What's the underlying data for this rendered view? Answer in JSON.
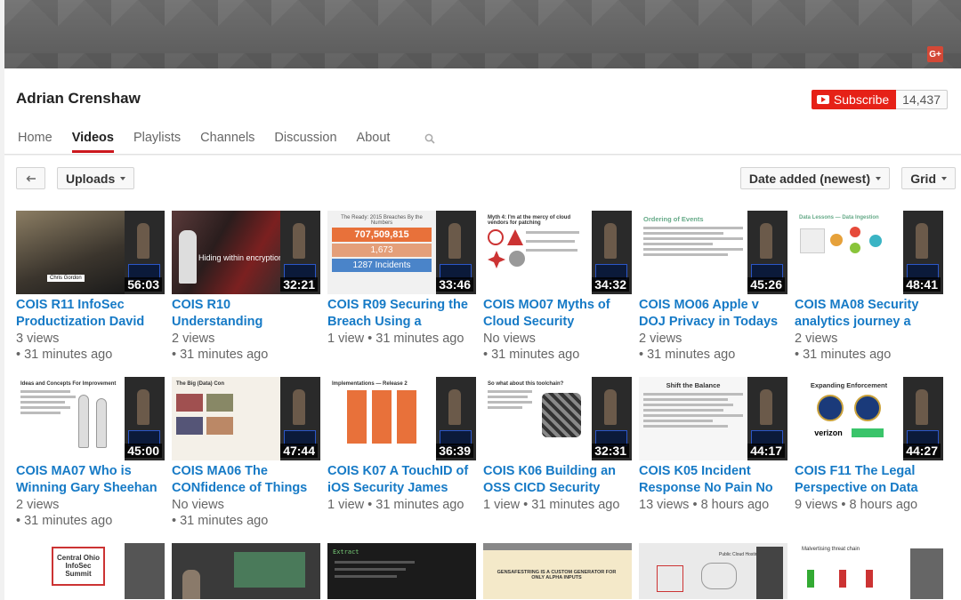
{
  "channel": {
    "name": "Adrian Crenshaw",
    "subscribe_label": "Subscribe",
    "subscriber_count": "14,437",
    "gplus_label": "G+"
  },
  "tabs": [
    {
      "label": "Home",
      "active": false
    },
    {
      "label": "Videos",
      "active": true
    },
    {
      "label": "Playlists",
      "active": false
    },
    {
      "label": "Channels",
      "active": false
    },
    {
      "label": "Discussion",
      "active": false
    },
    {
      "label": "About",
      "active": false
    }
  ],
  "toolbar": {
    "uploads_label": "Uploads",
    "sort_label": "Date added (newest)",
    "view_label": "Grid"
  },
  "colors": {
    "accent": "#cc181e",
    "subscribe": "#e62117",
    "link": "#167ac6"
  },
  "videos": [
    {
      "title": "COIS R11 InfoSec Productization David",
      "views": "3 views",
      "age": "31 minutes ago",
      "meta_inline": false,
      "duration": "56:03"
    },
    {
      "title": "COIS R10 Understanding",
      "views": "2 views",
      "age": "31 minutes ago",
      "meta_inline": false,
      "duration": "32:21"
    },
    {
      "title": "COIS R09 Securing the Breach Using a Holisti…",
      "views": "1 view",
      "age": "31 minutes ago",
      "meta_inline": true,
      "duration": "33:46"
    },
    {
      "title": "COIS MO07 Myths of Cloud Security",
      "views": "No views",
      "age": "31 minutes ago",
      "meta_inline": false,
      "duration": "34:32"
    },
    {
      "title": "COIS MO06 Apple v DOJ Privacy in Todays",
      "views": "2 views",
      "age": "31 minutes ago",
      "meta_inline": false,
      "duration": "45:26"
    },
    {
      "title": "COIS MA08 Security analytics journey a",
      "views": "2 views",
      "age": "31 minutes ago",
      "meta_inline": false,
      "duration": "48:41"
    },
    {
      "title": "COIS MA07 Who is Winning Gary Sheehan",
      "views": "2 views",
      "age": "31 minutes ago",
      "meta_inline": false,
      "duration": "45:00"
    },
    {
      "title": "COIS MA06 The CONfidence of Things",
      "views": "No views",
      "age": "31 minutes ago",
      "meta_inline": false,
      "duration": "47:44"
    },
    {
      "title": "COIS K07 A TouchID of iOS Security James",
      "views": "1 view",
      "age": "31 minutes ago",
      "meta_inline": true,
      "duration": "36:39"
    },
    {
      "title": "COIS K06 Building an OSS CICD Security",
      "views": "1 view",
      "age": "31 minutes ago",
      "meta_inline": true,
      "duration": "32:31"
    },
    {
      "title": "COIS K05 Incident Response No Pain No",
      "views": "13 views",
      "age": "8 hours ago",
      "meta_inline": true,
      "duration": "44:17"
    },
    {
      "title": "COIS F11 The Legal Perspective on Data",
      "views": "9 views",
      "age": "8 hours ago",
      "meta_inline": true,
      "duration": "44:27"
    }
  ],
  "thumb_text": {
    "r11_caption": "Chris Gordon",
    "r10_caption": "Hiding within encryption",
    "r09_title": "The Ready: 2015 Breaches By the Numbers",
    "r09_big": "707,509,815",
    "r09_mid": "1,673",
    "r09_incidents": "1287 Incidents",
    "mo07_title": "Myth 4: I'm at the mercy of cloud vendors for patching",
    "mo06_title": "Ordering of Events",
    "ma08_title": "Data Lessons — Data Ingestion",
    "ma07_title": "Ideas and Concepts For Improvement",
    "ma06_title": "The Big (Data) Con",
    "k07_title": "Implementations — Release 2",
    "k06_title": "So what about this toolchain?",
    "k05_title": "Shift the Balance",
    "f11_title": "Expanding Enforcement",
    "f11_brand": "verizon",
    "r3_1_title": "Central Ohio InfoSec Summit",
    "r3_3_title": "Extract",
    "r3_4_title": "GENSAFESTRING IS A CUSTOM GENERATOR FOR ONLY ALPHA INPUTS",
    "r3_5_title": "Public Cloud Hosting Model",
    "r3_6_title": "Malvertising threat chain"
  }
}
